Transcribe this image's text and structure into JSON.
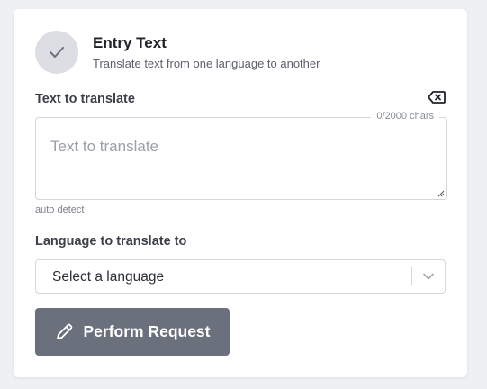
{
  "step": {
    "title": "Entry Text",
    "subtitle": "Translate text from one language to another",
    "icon": "check-icon"
  },
  "text_field": {
    "label": "Text to translate",
    "placeholder": "Text to translate",
    "value": "",
    "char_count": "0/2000 chars",
    "hint": "auto detect",
    "clear_icon": "backspace-clear-icon"
  },
  "language_field": {
    "label": "Language to translate to",
    "selected": "Select a language",
    "icon": "chevron-down-icon"
  },
  "submit": {
    "label": "Perform Request",
    "icon": "pencil-icon"
  },
  "colors": {
    "page_bg": "#eff0f3",
    "card_bg": "#ffffff",
    "button_bg": "#6b717c",
    "step_circle": "#dcdee3"
  }
}
